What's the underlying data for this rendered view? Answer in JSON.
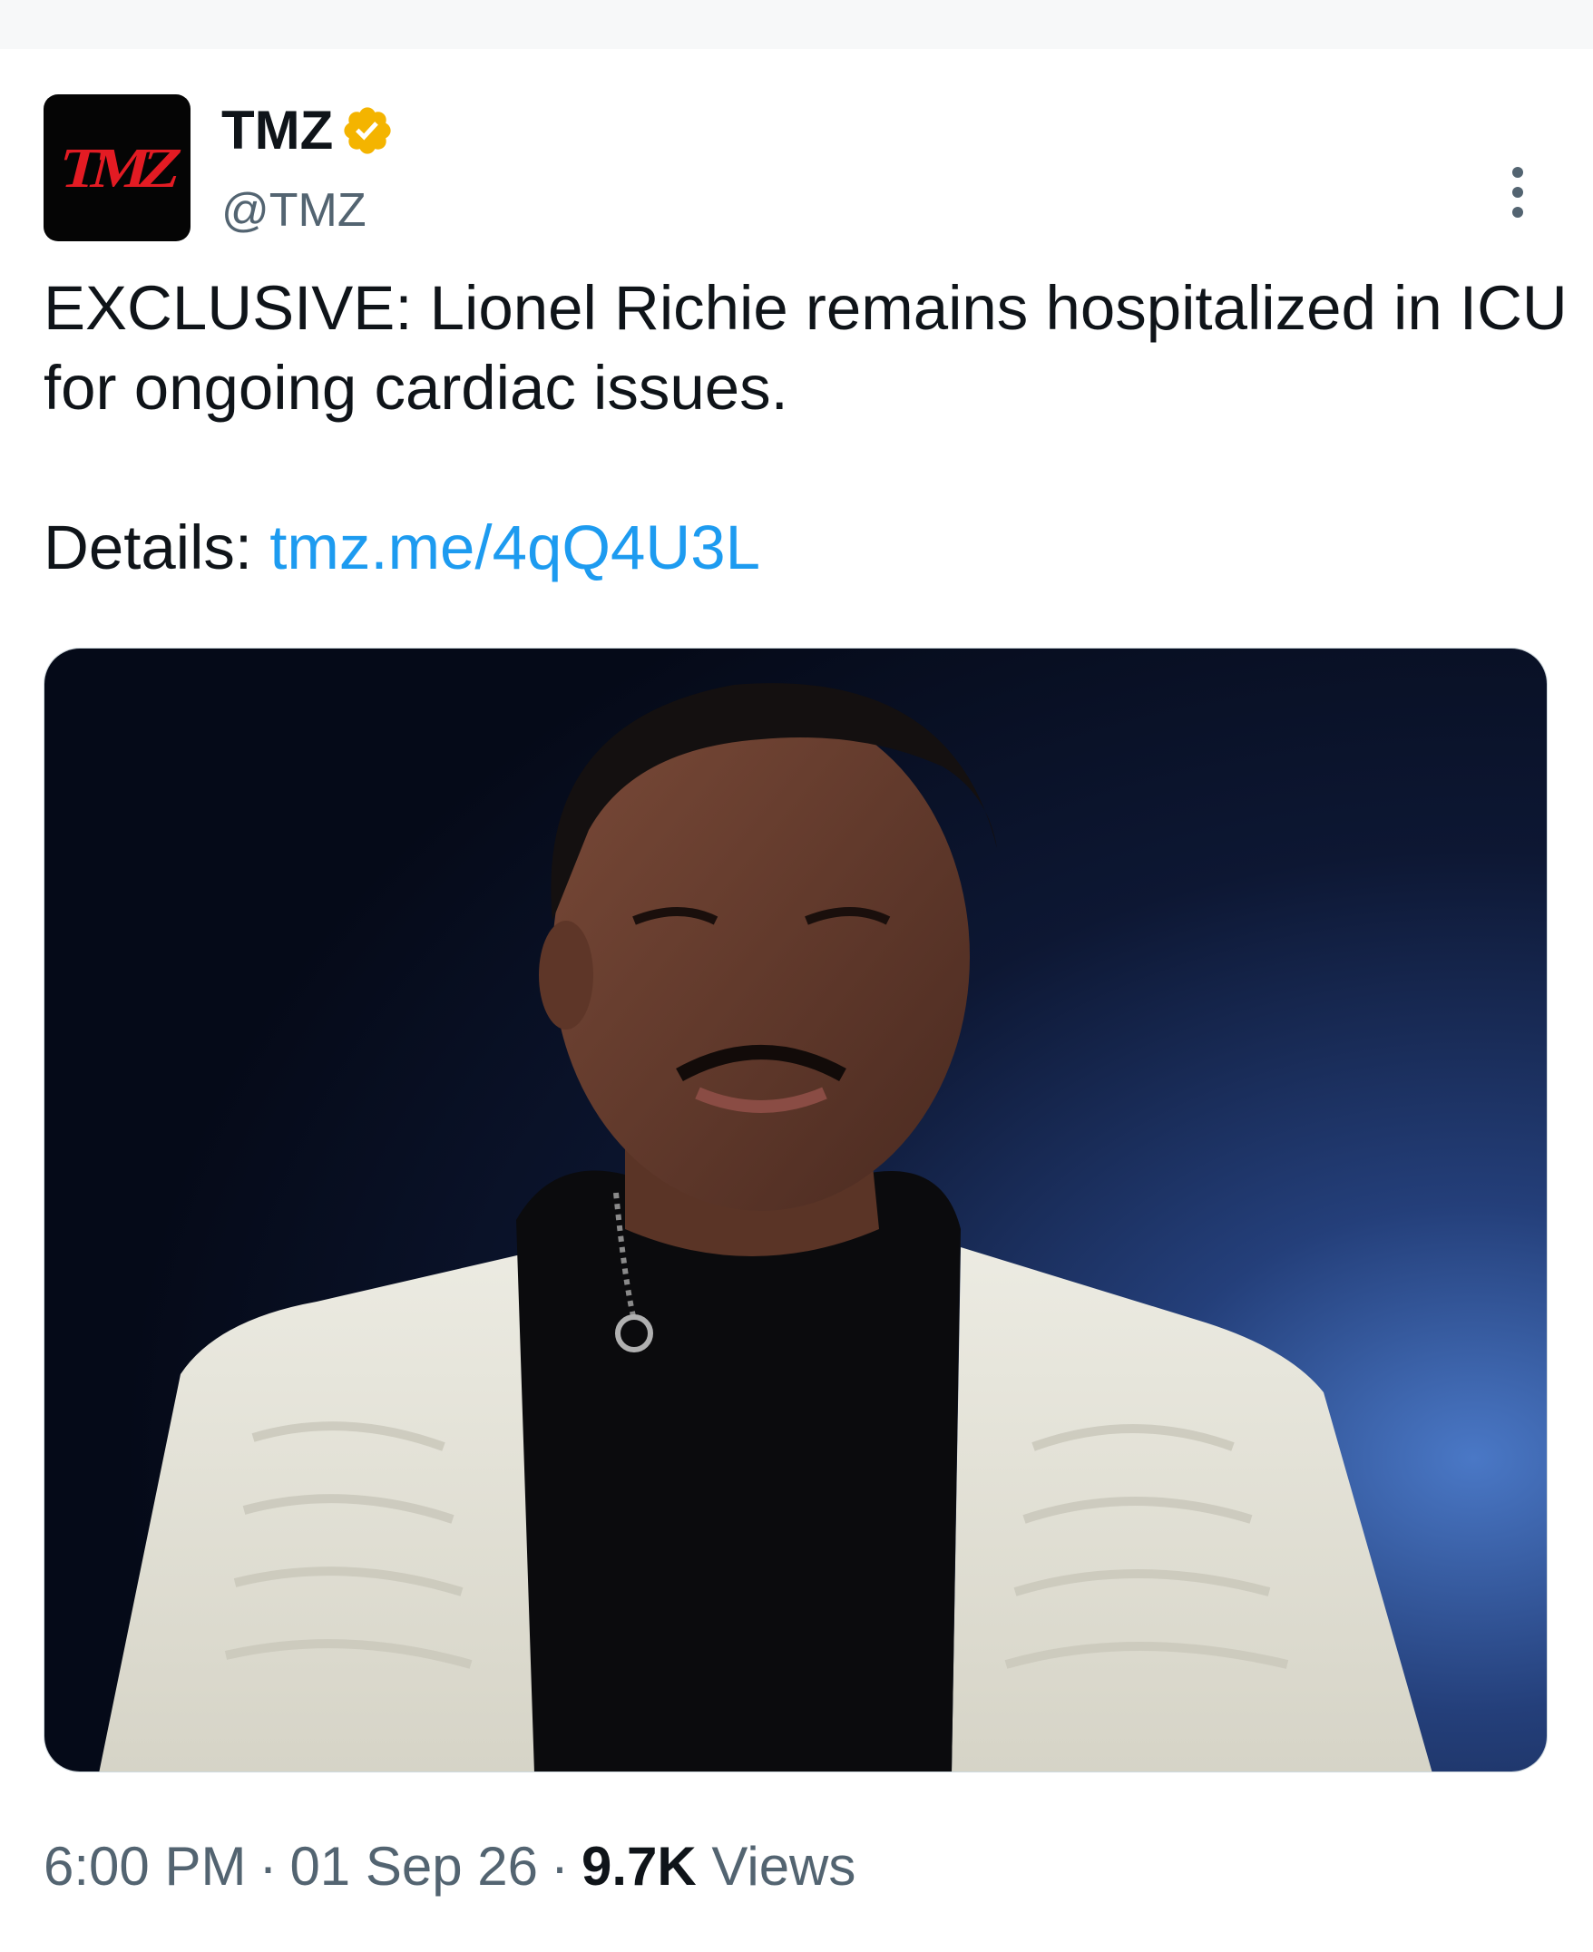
{
  "author": {
    "display_name": "TMZ",
    "handle": "@TMZ",
    "avatar_text": "TMZ",
    "verified_icon": "verified-badge-icon",
    "verified_color": "#f4b400"
  },
  "tweet": {
    "text_line": "EXCLUSIVE: Lionel Richie remains hospitalized in ICU for ongoing cardiac issues.",
    "details_label": "Details: ",
    "details_link": "tmz.me/4qQ4U3L",
    "link_color": "#1d9bf0"
  },
  "media": {
    "alt": "Photo of Lionel Richie on stage wearing a white embroidered jacket over a black shirt"
  },
  "meta": {
    "time": "6:00 PM",
    "separator": "·",
    "date": "01 Sep 26",
    "views_count": "9.7K",
    "views_label": "Views"
  },
  "actions": {
    "more_icon": "more-options-icon"
  }
}
